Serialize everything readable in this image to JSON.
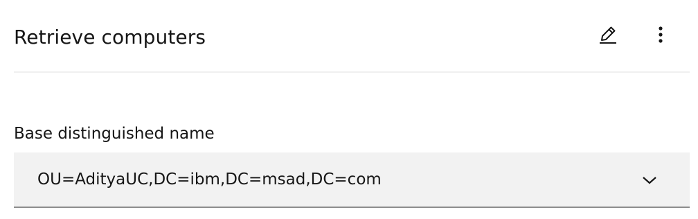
{
  "header": {
    "title": "Retrieve computers",
    "edit_icon": "pencil-icon",
    "more_icon": "overflow-menu-vertical-icon"
  },
  "field": {
    "label": "Base distinguished name",
    "value": "OU=AdityaUC,DC=ibm,DC=msad,DC=com",
    "dropdown_icon": "chevron-down-icon"
  },
  "colors": {
    "text": "#161616",
    "field_background": "#f2f2f2",
    "field_underline": "#8d8d8d",
    "divider": "#f0f0f0"
  }
}
